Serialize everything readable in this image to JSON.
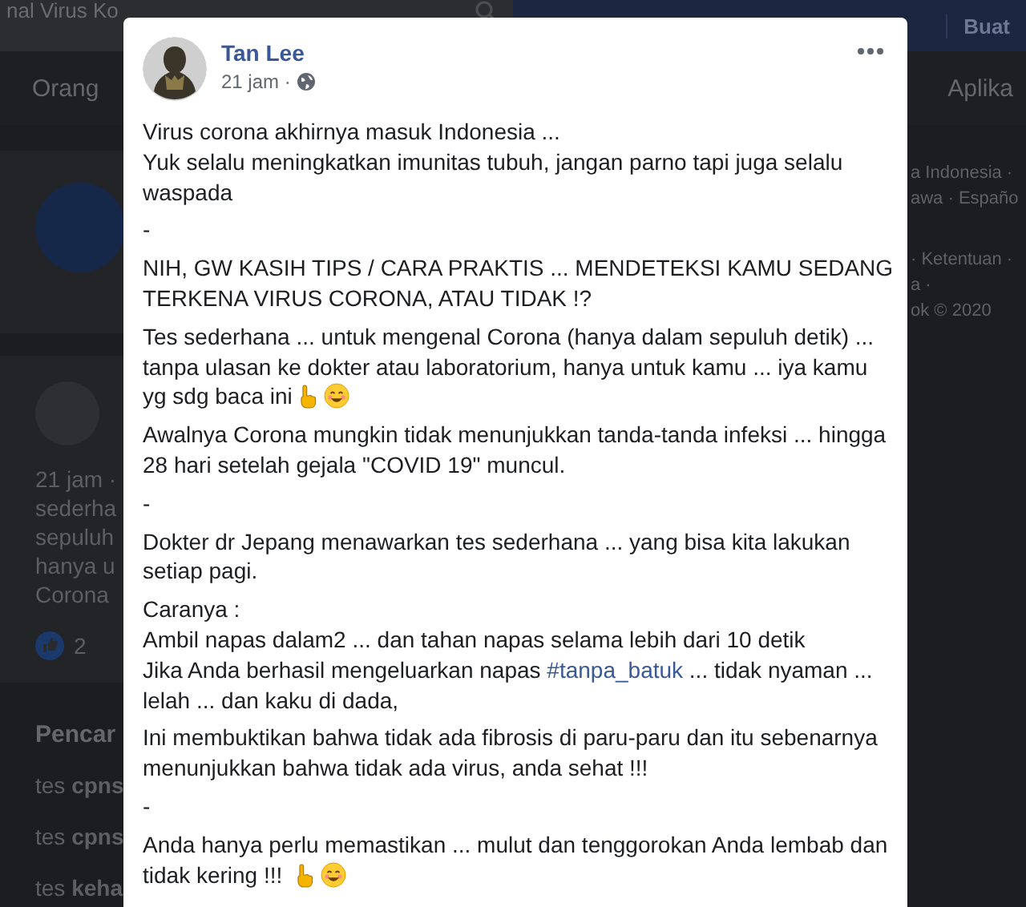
{
  "background": {
    "topbar": {
      "search_text": "nal Virus Ko",
      "nav": [
        "Buat"
      ]
    },
    "subnav": [
      "Orang",
      "Aplika"
    ],
    "feed_post": {
      "meta": "21 jam ·",
      "lines": [
        "sederha",
        "sepuluh",
        "hanya u",
        "Corona"
      ],
      "likes": "2"
    },
    "searches": {
      "title": "Pencar",
      "items": [
        {
          "prefix": "tes ",
          "bold": "cpns"
        },
        {
          "prefix": "tes ",
          "bold": "cpns"
        },
        {
          "prefix": "tes ",
          "bold": "keha"
        }
      ]
    },
    "right_links": [
      "a Indonesia ·",
      "awa · Españo",
      "· Ketentuan ·",
      "a ·",
      "ok © 2020"
    ]
  },
  "post": {
    "author": "Tan Lee",
    "time": "21 jam ·",
    "paragraphs": [
      {
        "lines": [
          [
            {
              "text": "Virus corona akhirnya masuk Indonesia ..."
            }
          ],
          [
            {
              "text": "Yuk selalu meningkatkan imunitas tubuh, jangan parno tapi juga selalu waspada"
            }
          ]
        ]
      },
      {
        "lines": [
          [
            {
              "text": "-"
            }
          ]
        ]
      },
      {
        "lines": [
          [
            {
              "text": "NIH, GW KASIH TIPS / CARA PRAKTIS ... MENDETEKSI KAMU SEDANG TERKENA VIRUS CORONA, ATAU TIDAK !?"
            }
          ]
        ]
      },
      {
        "lines": [
          [
            {
              "text": "Tes sederhana ... untuk mengenal Corona (hanya dalam sepuluh detik) ... tanpa ulasan ke dokter atau laboratorium, hanya untuk kamu ... iya kamu yg sdg baca ini"
            }
          ]
        ],
        "emoji": true
      },
      {
        "lines": [
          [
            {
              "text": "Awalnya Corona mungkin tidak menunjukkan tanda-tanda infeksi ... hingga 28 hari setelah gejala \"COVID 19\" muncul."
            }
          ]
        ]
      },
      {
        "lines": [
          [
            {
              "text": "-"
            }
          ]
        ]
      },
      {
        "lines": [
          [
            {
              "text": "Dokter dr Jepang menawarkan tes sederhana ... yang bisa kita lakukan setiap pagi."
            }
          ]
        ]
      },
      {
        "lines": [
          [
            {
              "text": "Caranya :"
            }
          ],
          [
            {
              "text": "Ambil napas dalam2 ... dan tahan napas selama lebih dari 10 detik"
            }
          ],
          [
            {
              "text": "Jika Anda berhasil mengeluarkan napas "
            },
            {
              "kind": "hashtag",
              "text": "#tanpa_batuk"
            },
            {
              "text": " ... tidak nyaman ... lelah ... dan kaku di dada,"
            }
          ]
        ]
      },
      {
        "lines": [
          [
            {
              "text": "Ini membuktikan bahwa tidak ada fibrosis di paru-paru dan itu sebenarnya menunjukkan bahwa tidak ada virus, anda sehat !!!"
            }
          ]
        ]
      },
      {
        "lines": [
          [
            {
              "text": "-"
            }
          ]
        ]
      },
      {
        "lines": [
          [
            {
              "text": "Anda hanya perlu memastikan ... mulut dan tenggorokan Anda lembab dan tidak kering !!! "
            }
          ]
        ],
        "emoji": true
      }
    ]
  }
}
